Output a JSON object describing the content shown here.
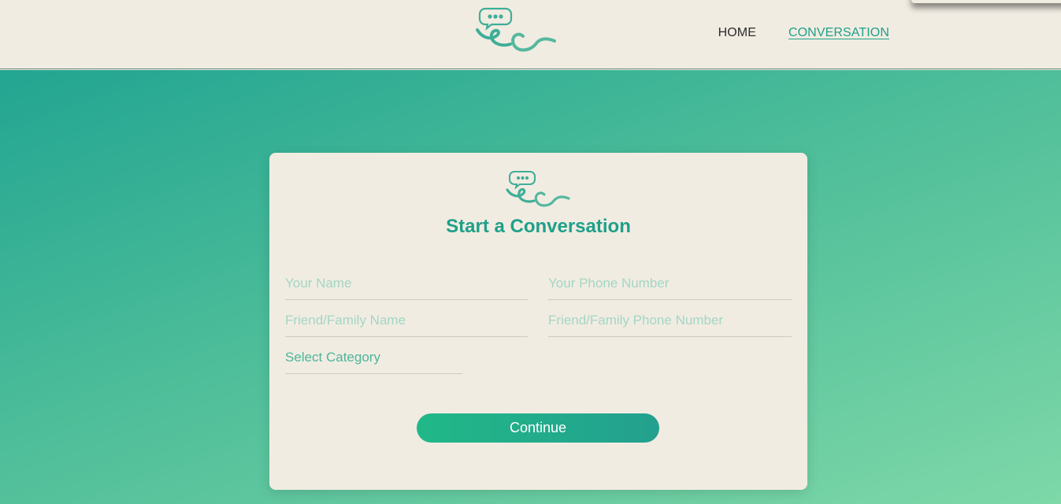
{
  "colors": {
    "brand": "#1fa08a",
    "background": "#f1ece2",
    "gradient_start": "#22a592",
    "gradient_end": "#7ed8a8"
  },
  "header": {
    "logo_icon": "ec-chat-logo-icon",
    "nav": [
      {
        "label": "HOME",
        "active": false
      },
      {
        "label": "CONVERSATION",
        "active": true
      }
    ]
  },
  "card": {
    "logo_icon": "ec-chat-logo-icon",
    "title": "Start a Conversation",
    "fields": {
      "your_name": {
        "placeholder": "Your Name",
        "value": ""
      },
      "your_phone": {
        "placeholder": "Your Phone Number",
        "value": ""
      },
      "friend_name": {
        "placeholder": "Friend/Family Name",
        "value": ""
      },
      "friend_phone": {
        "placeholder": "Friend/Family Phone Number",
        "value": ""
      },
      "category": {
        "selected": "Select Category"
      }
    },
    "continue_label": "Continue"
  }
}
